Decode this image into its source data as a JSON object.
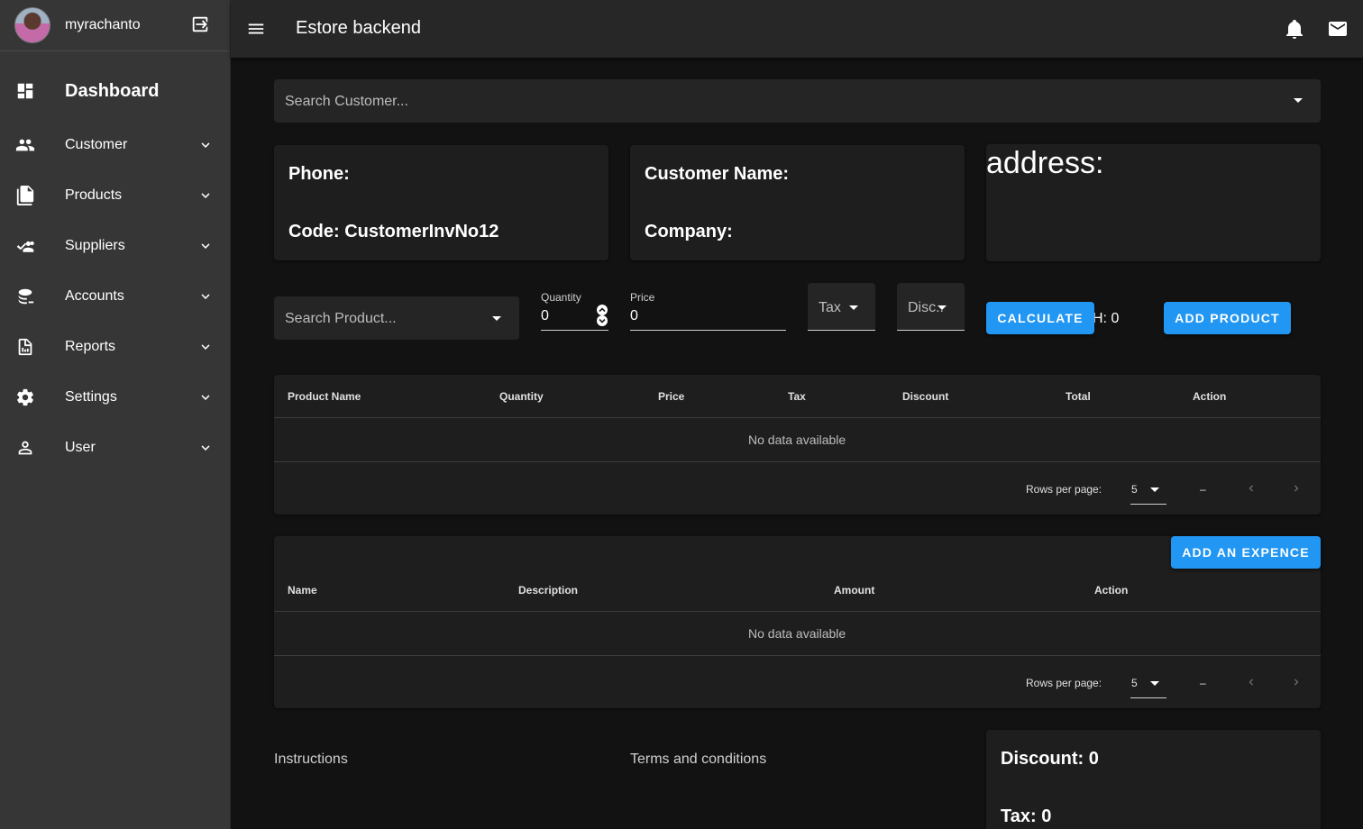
{
  "user": {
    "name": "myrachanto"
  },
  "sidebar": {
    "items": [
      {
        "label": "Dashboard",
        "icon": "dashboard-icon"
      },
      {
        "label": "Customer",
        "icon": "people-icon"
      },
      {
        "label": "Products",
        "icon": "document-icon"
      },
      {
        "label": "Suppliers",
        "icon": "supplier-icon"
      },
      {
        "label": "Accounts",
        "icon": "database-icon"
      },
      {
        "label": "Reports",
        "icon": "report-icon"
      },
      {
        "label": "Settings",
        "icon": "gear-icon"
      },
      {
        "label": "User",
        "icon": "person-icon"
      }
    ]
  },
  "appbar": {
    "title": "Estore backend"
  },
  "customer_search": {
    "placeholder": "Search Customer..."
  },
  "info": {
    "phone_label": "Phone:",
    "code_label": "Code: CustomerInvNo12",
    "customer_name_label": "Customer Name:",
    "company_label": "Company:",
    "address_label": "address:"
  },
  "product_form": {
    "search_placeholder": "Search Product...",
    "quantity_label": "Quantity",
    "quantity_value": "0",
    "price_label": "Price",
    "price_value": "0",
    "tax_label": "Tax",
    "discount_label": "Disc...",
    "calculate_label": "Calculate",
    "subtotal_text": "H: 0",
    "add_product_label": "Add Product"
  },
  "products_table": {
    "headers": [
      "Product Name",
      "Quantity",
      "Price",
      "Tax",
      "Discount",
      "Total",
      "Action"
    ],
    "empty_text": "No data available",
    "rows_per_page_label": "Rows per page:",
    "rows_per_page_value": "5",
    "range_text": "–"
  },
  "expenses_table": {
    "add_label": "Add an expence",
    "headers": [
      "Name",
      "Description",
      "Amount",
      "Action"
    ],
    "empty_text": "No data available",
    "rows_per_page_label": "Rows per page:",
    "rows_per_page_value": "5",
    "range_text": "–"
  },
  "footer": {
    "instructions_label": "Instructions",
    "terms_label": "Terms and conditions",
    "discount_text": "Discount: 0",
    "tax_text": "Tax: 0"
  },
  "colors": {
    "accent": "#2196f3",
    "background": "#121212",
    "sidebar": "#363636",
    "appbar": "#272727"
  }
}
